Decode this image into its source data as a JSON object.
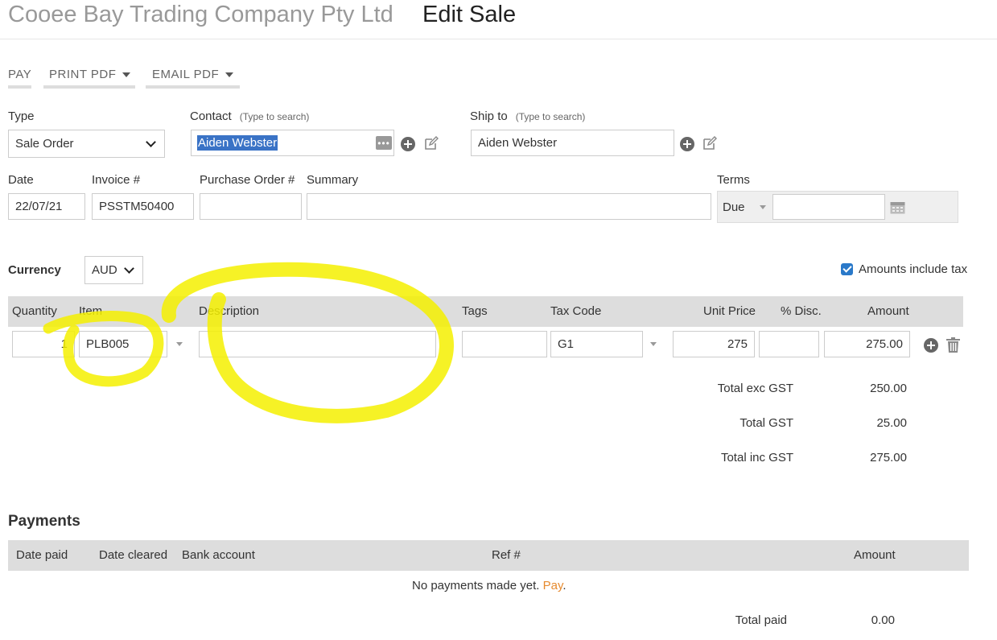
{
  "header": {
    "company": "Cooee Bay Trading Company Pty Ltd",
    "title": "Edit Sale"
  },
  "toolbar": {
    "pay": "PAY",
    "print_pdf": "PRINT PDF",
    "email_pdf": "EMAIL PDF"
  },
  "form": {
    "type_label": "Type",
    "type_value": "Sale Order",
    "contact_label": "Contact",
    "contact_hint": "(Type to search)",
    "contact_value": "Aiden Webster",
    "ship_label": "Ship to",
    "ship_hint": "(Type to search)",
    "ship_value": "Aiden Webster",
    "date_label": "Date",
    "date_value": "22/07/21",
    "invoice_label": "Invoice #",
    "invoice_value": "PSSTM50400",
    "po_label": "Purchase Order #",
    "po_value": "",
    "summary_label": "Summary",
    "summary_value": "",
    "terms_label": "Terms",
    "terms_value": "Due",
    "terms_days": "",
    "currency_label": "Currency",
    "currency_value": "AUD",
    "amounts_include_tax_label": "Amounts include tax",
    "amounts_include_tax": true
  },
  "lines": {
    "headers": {
      "quantity": "Quantity",
      "item": "Item",
      "description": "Description",
      "tags": "Tags",
      "tax_code": "Tax Code",
      "unit_price": "Unit Price",
      "disc": "% Disc.",
      "amount": "Amount"
    },
    "rows": [
      {
        "quantity": "1",
        "item": "PLB005",
        "description": "",
        "tags": "",
        "tax_code": "G1",
        "unit_price": "275",
        "disc": "",
        "amount": "275.00"
      }
    ]
  },
  "totals": {
    "exc_label": "Total exc GST",
    "exc_value": "250.00",
    "gst_label": "Total GST",
    "gst_value": "25.00",
    "inc_label": "Total inc GST",
    "inc_value": "275.00"
  },
  "payments": {
    "title": "Payments",
    "headers": {
      "date_paid": "Date paid",
      "date_cleared": "Date cleared",
      "bank_account": "Bank account",
      "ref": "Ref #",
      "amount": "Amount"
    },
    "empty_text": "No payments made yet.",
    "pay_link": "Pay",
    "empty_suffix": ".",
    "total_paid_label": "Total paid",
    "total_paid_value": "0.00"
  },
  "colors": {
    "highlight_annotation": "#f5f000",
    "selection": "#3a73c6",
    "link": "#e68a2e",
    "checkbox": "#2a79c9"
  },
  "icons": {
    "add": "plus-circle-icon",
    "edit": "edit-icon",
    "delete": "trash-icon",
    "calendar": "calendar-icon",
    "more": "ellipsis-icon"
  }
}
